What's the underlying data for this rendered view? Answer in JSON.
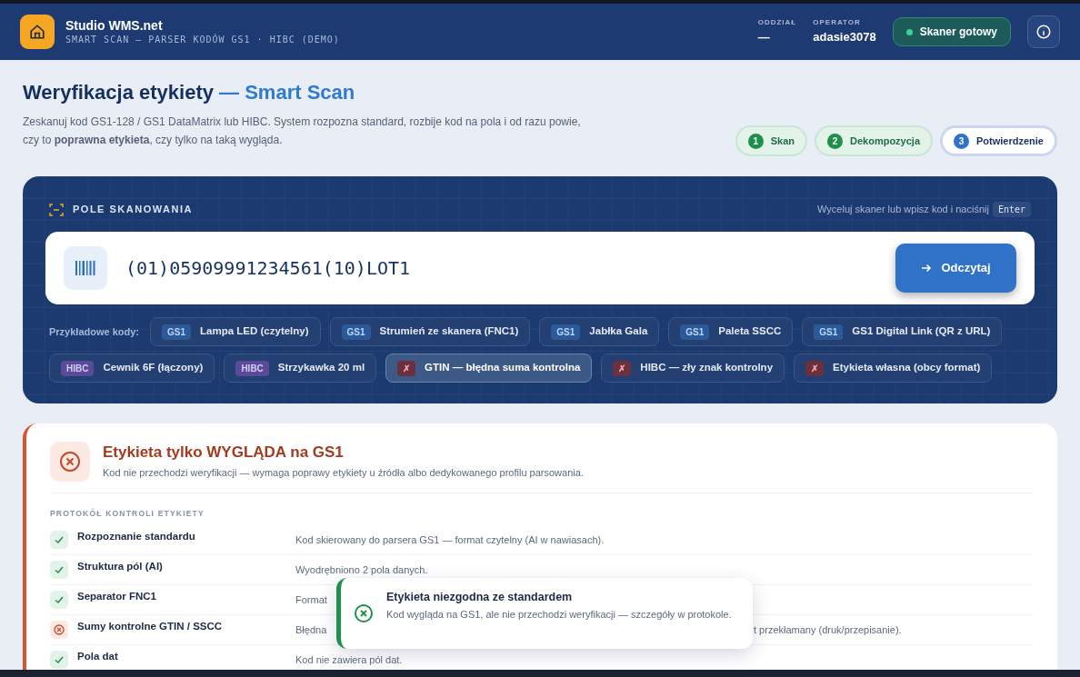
{
  "header": {
    "app_name": "Studio WMS.net",
    "subtitle": "SMART SCAN — PARSER KODÓW GS1 · HIBC (DEMO)",
    "branch_label": "ODDZIAŁ",
    "branch_value": "—",
    "operator_label": "OPERATOR",
    "operator_value": "adasie3078",
    "scanner_status": {
      "label": "Skaner gotowy",
      "on": true
    }
  },
  "page": {
    "title": "Weryfikacja etykiety",
    "title_accent": "— Smart Scan",
    "description": "Zeskanuj kod GS1-128 / GS1 DataMatrix lub HIBC. System rozpozna standard, rozbije kod na pola i od razu powie, czy to **poprawna etykieta**, czy tylko na taką wygląda."
  },
  "steps": [
    {
      "number": "1",
      "label": "Skan",
      "selected": false
    },
    {
      "number": "2",
      "label": "Dekompozycja",
      "selected": false
    },
    {
      "number": "3",
      "label": "Potwierdzenie",
      "selected": true
    }
  ],
  "scan_panel": {
    "title": "POLE SKANOWANIA",
    "hint": "Wyceluj skaner lub wpisz kod i naciśnij",
    "hint_key": "Enter",
    "value": "(01)05909991234561(10)LOT1",
    "button": "Odczytaj",
    "examples_label": "Przykładowe kody:",
    "examples": [
      {
        "tag": "GS1",
        "kind": "gs1",
        "label": "Lampa LED (czytelny)",
        "selected": false
      },
      {
        "tag": "GS1",
        "kind": "gs1",
        "label": "Strumień ze skanera (FNC1)",
        "selected": false
      },
      {
        "tag": "GS1",
        "kind": "gs1",
        "label": "Jabłka Gala",
        "selected": false
      },
      {
        "tag": "GS1",
        "kind": "gs1",
        "label": "Paleta SSCC",
        "selected": false
      },
      {
        "tag": "GS1",
        "kind": "gs1",
        "label": "GS1 Digital Link (QR z URL)",
        "selected": false
      },
      {
        "tag": "HIBC",
        "kind": "hibc",
        "label": "Cewnik 6F (łączony)",
        "selected": false
      },
      {
        "tag": "HIBC",
        "kind": "hibc",
        "label": "Strzykawka 20 ml",
        "selected": false
      },
      {
        "tag": "✗",
        "kind": "error",
        "label": "GTIN — błędna suma kontrolna",
        "selected": true
      },
      {
        "tag": "✗",
        "kind": "error",
        "label": "HIBC — zły znak kontrolny",
        "selected": false
      },
      {
        "tag": "✗",
        "kind": "error",
        "label": "Etykieta własna (obcy format)",
        "selected": false
      }
    ]
  },
  "result": {
    "passed": false,
    "title": "Etykieta tylko WYGLĄDA na GS1",
    "subtitle": "Kod nie przechodzi weryfikacji — wymaga poprawy etykiety u źródła albo dedykowanego profilu parsowania.",
    "protocol_title": "PROTOKÓŁ KONTROLI ETYKIETY",
    "checks": [
      {
        "passed": true,
        "name": "Rozpoznanie standardu",
        "detail": "Kod skierowany do parsera GS1 — format czytelny (AI w nawiasach)."
      },
      {
        "passed": true,
        "name": "Struktura pól (AI)",
        "detail": "Wyodrębniono 2 pola danych."
      },
      {
        "passed": true,
        "name": "Separator FNC1",
        "detail": "Format"
      },
      {
        "passed": false,
        "name": "Sumy kontrolne GTIN / SSCC",
        "detail": "Błędna",
        "detail_tail": "t przekłamany (druk/przepisanie)."
      },
      {
        "passed": true,
        "name": "Pola dat",
        "detail": "Kod nie zawiera pól dat."
      }
    ]
  },
  "toast": {
    "title": "Etykieta niezgodna ze standardem",
    "message": "Kod wygląda na GS1, ale nie przechodzi weryfikacji — szczegóły w protokole."
  }
}
